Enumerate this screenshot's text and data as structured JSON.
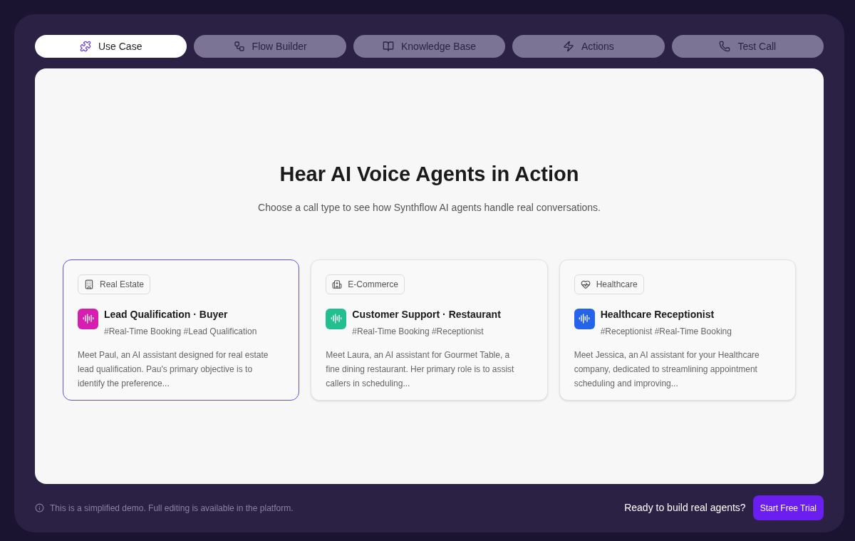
{
  "tabs": [
    {
      "label": "Use Case",
      "selected": true
    },
    {
      "label": "Flow Builder",
      "selected": false
    },
    {
      "label": "Knowledge Base",
      "selected": false
    },
    {
      "label": "Actions",
      "selected": false
    },
    {
      "label": "Test Call",
      "selected": false
    }
  ],
  "heading": "Hear AI Voice Agents in Action",
  "subheading": "Choose a call type to see how Synthflow AI agents handle real conversations.",
  "cards": [
    {
      "category": "Real Estate",
      "title": "Lead Qualification · Buyer",
      "tags": "#Real-Time Booking #Lead Qualification",
      "description": "Meet Paul, an AI assistant designed for real estate lead qualification. Pau's primary objective is to identify the preference...",
      "color": "#d61fb0",
      "selected": true
    },
    {
      "category": "E-Commerce",
      "title": "Customer Support · Restaurant",
      "tags": "#Real-Time Booking #Receptionist",
      "description": "Meet Laura, an AI assistant for Gourmet Table, a fine dining restaurant. Her primary role is to assist callers in scheduling...",
      "color": "#22c08f",
      "selected": false
    },
    {
      "category": "Healthcare",
      "title": "Healthcare Receptionist",
      "tags": "#Receptionist #Real-Time Booking",
      "description": "Meet Jessica, an AI assistant for your Healthcare company, dedicated to streamlining appointment scheduling and improving...",
      "color": "#2563eb",
      "selected": false
    }
  ],
  "footer": {
    "note": "This is a simplified demo. Full editing is available in the platform.",
    "prompt": "Ready to build real agents?",
    "button": "Start Free Trial"
  }
}
